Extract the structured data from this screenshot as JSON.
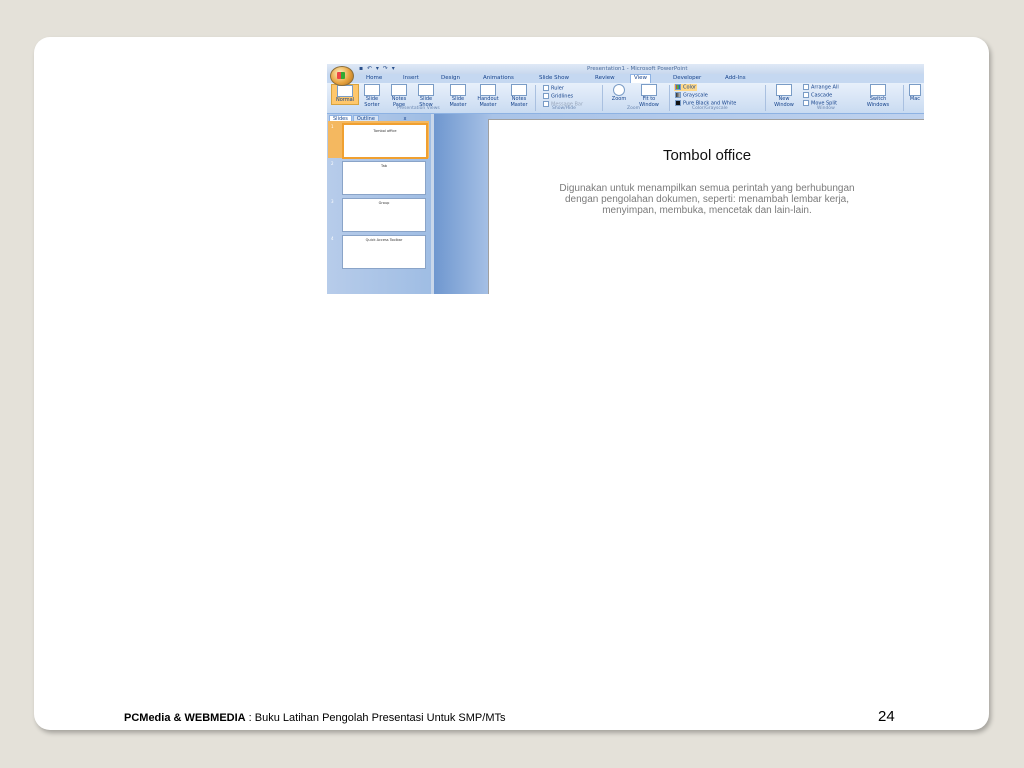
{
  "window": {
    "title": "Presentation1 - Microsoft PowerPoint",
    "qat": "▪ ↶ ▾ ↷ ▾"
  },
  "tabs": [
    "Home",
    "Insert",
    "Design",
    "Animations",
    "Slide Show",
    "Review",
    "View",
    "Developer",
    "Add-Ins"
  ],
  "active_tab": "View",
  "ribbon": {
    "presentation_views": {
      "label": "Presentation Views",
      "buttons": [
        "Normal",
        "Slide Sorter",
        "Notes Page",
        "Slide Show",
        "Slide Master",
        "Handout Master",
        "Notes Master"
      ]
    },
    "show_hide": {
      "label": "Show/Hide",
      "items": [
        "Ruler",
        "Gridlines",
        "Message Bar"
      ]
    },
    "zoom": {
      "label": "Zoom",
      "buttons": [
        "Zoom",
        "Fit to Window"
      ]
    },
    "color_grayscale": {
      "label": "Color/Grayscale",
      "items": [
        "Color",
        "Grayscale",
        "Pure Black and White"
      ]
    },
    "window": {
      "label": "Window",
      "new_window": "New Window",
      "items": [
        "Arrange All",
        "Cascade",
        "Move Split"
      ],
      "switch": "Switch Windows"
    },
    "macros": "Mac"
  },
  "slide_panel": {
    "tabs": [
      "Slides",
      "Outline"
    ],
    "close": "x",
    "thumbnails": [
      {
        "num": "1",
        "title": "Tombol office"
      },
      {
        "num": "2",
        "title": "Tab"
      },
      {
        "num": "3",
        "title": "Group"
      },
      {
        "num": "4",
        "title": "Quick Access Toolbar"
      }
    ]
  },
  "slide": {
    "title": "Tombol office",
    "body": "Digunakan untuk menampilkan semua perintah yang berhubungan dengan pengolahan dokumen, seperti: menambah lembar kerja, menyimpan, membuka, mencetak dan lain-lain."
  },
  "footer": {
    "brand": "PCMedia & WEBMEDIA",
    "text": " : Buku Latihan Pengolah Presentasi Untuk SMP/MTs",
    "page": "24"
  },
  "colors": {
    "background": "#e4e1d9",
    "ribbon": "#c9dbf1",
    "selected_slide": "#f4b860",
    "accent": "#ffc76b"
  }
}
